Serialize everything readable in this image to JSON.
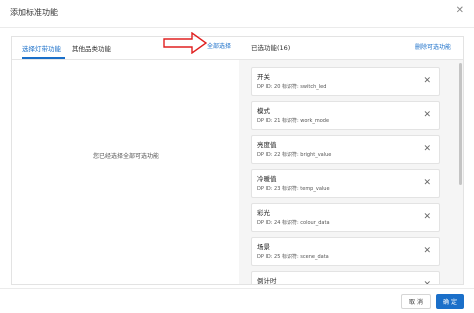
{
  "dialog": {
    "title": "添加标准功能"
  },
  "left": {
    "tabs": [
      {
        "label": "选择灯带功能"
      },
      {
        "label": "其他品类功能"
      }
    ],
    "select_all": "全部选择",
    "empty_message": "您已经选择全部可选功能"
  },
  "right": {
    "title": "已选功能(16)",
    "delete_label": "删除可选功能",
    "items": [
      {
        "name": "开关",
        "sub": "DP ID: 20   标识符: switch_led"
      },
      {
        "name": "模式",
        "sub": "DP ID: 21   标识符: work_mode"
      },
      {
        "name": "亮度值",
        "sub": "DP ID: 22   标识符: bright_value"
      },
      {
        "name": "冷暖值",
        "sub": "DP ID: 23   标识符: temp_value"
      },
      {
        "name": "彩光",
        "sub": "DP ID: 24   标识符: colour_data"
      },
      {
        "name": "场景",
        "sub": "DP ID: 25   标识符: scene_data"
      },
      {
        "name": "倒计时",
        "sub": ""
      }
    ]
  },
  "footer": {
    "cancel_label": "取 消",
    "ok_label": "确 定"
  },
  "icons": {
    "close": "close-icon",
    "remove": "remove-icon",
    "arrow": "arrow-right-icon"
  },
  "colors": {
    "accent": "#1a6fc9",
    "arrow": "#e02020"
  }
}
